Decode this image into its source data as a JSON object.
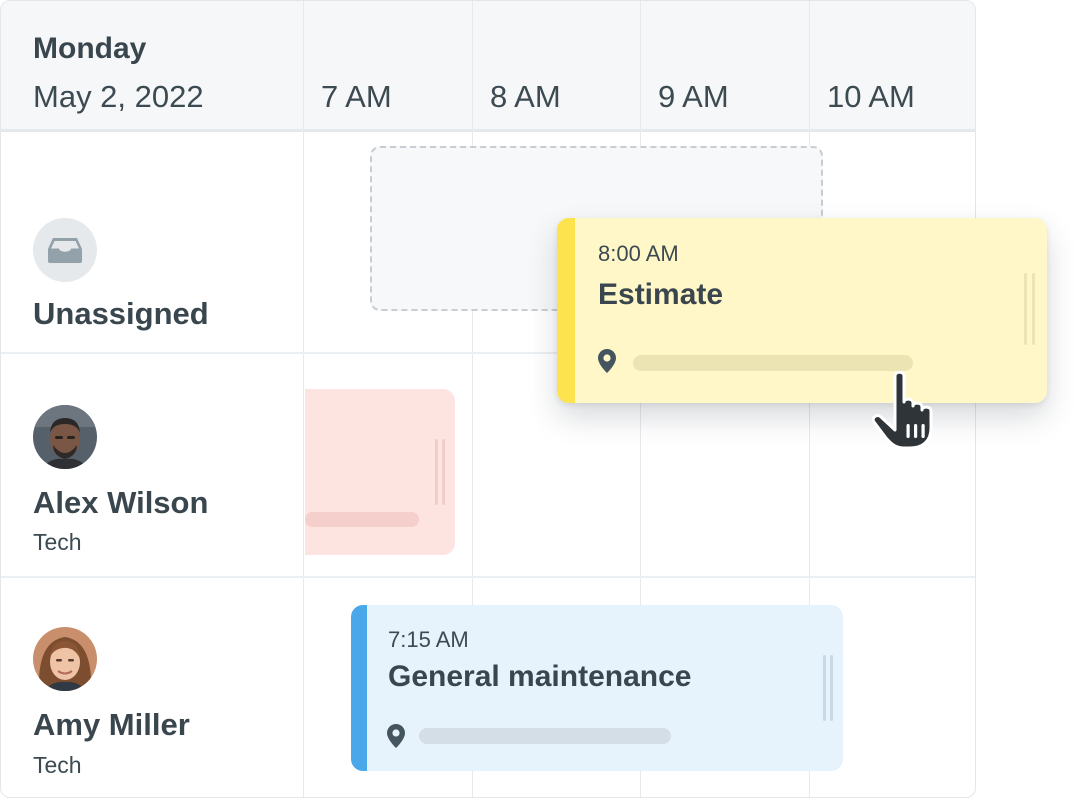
{
  "header": {
    "day_name": "Monday",
    "date": "May 2, 2022",
    "time_slots": [
      "7 AM",
      "8 AM",
      "9 AM",
      "10 AM"
    ]
  },
  "rows": [
    {
      "name": "Unassigned",
      "role": "",
      "icon": "inbox-icon"
    },
    {
      "name": "Alex Wilson",
      "role": "Tech",
      "icon": "avatar"
    },
    {
      "name": "Amy Miller",
      "role": "Tech",
      "icon": "avatar"
    }
  ],
  "events": {
    "dragging": {
      "time": "8:00 AM",
      "title": "Estimate",
      "icon": "location-pin-icon",
      "color": "#fde44f",
      "background": "#fff7c8"
    },
    "alex_card": {
      "background": "#fde4e1"
    },
    "amy_card": {
      "time": "7:15 AM",
      "title": "General maintenance",
      "icon": "location-pin-icon",
      "color": "#4aa7ea",
      "background": "#e6f2fc"
    }
  },
  "cursor": {
    "icon": "hand-pointer-cursor-icon"
  }
}
